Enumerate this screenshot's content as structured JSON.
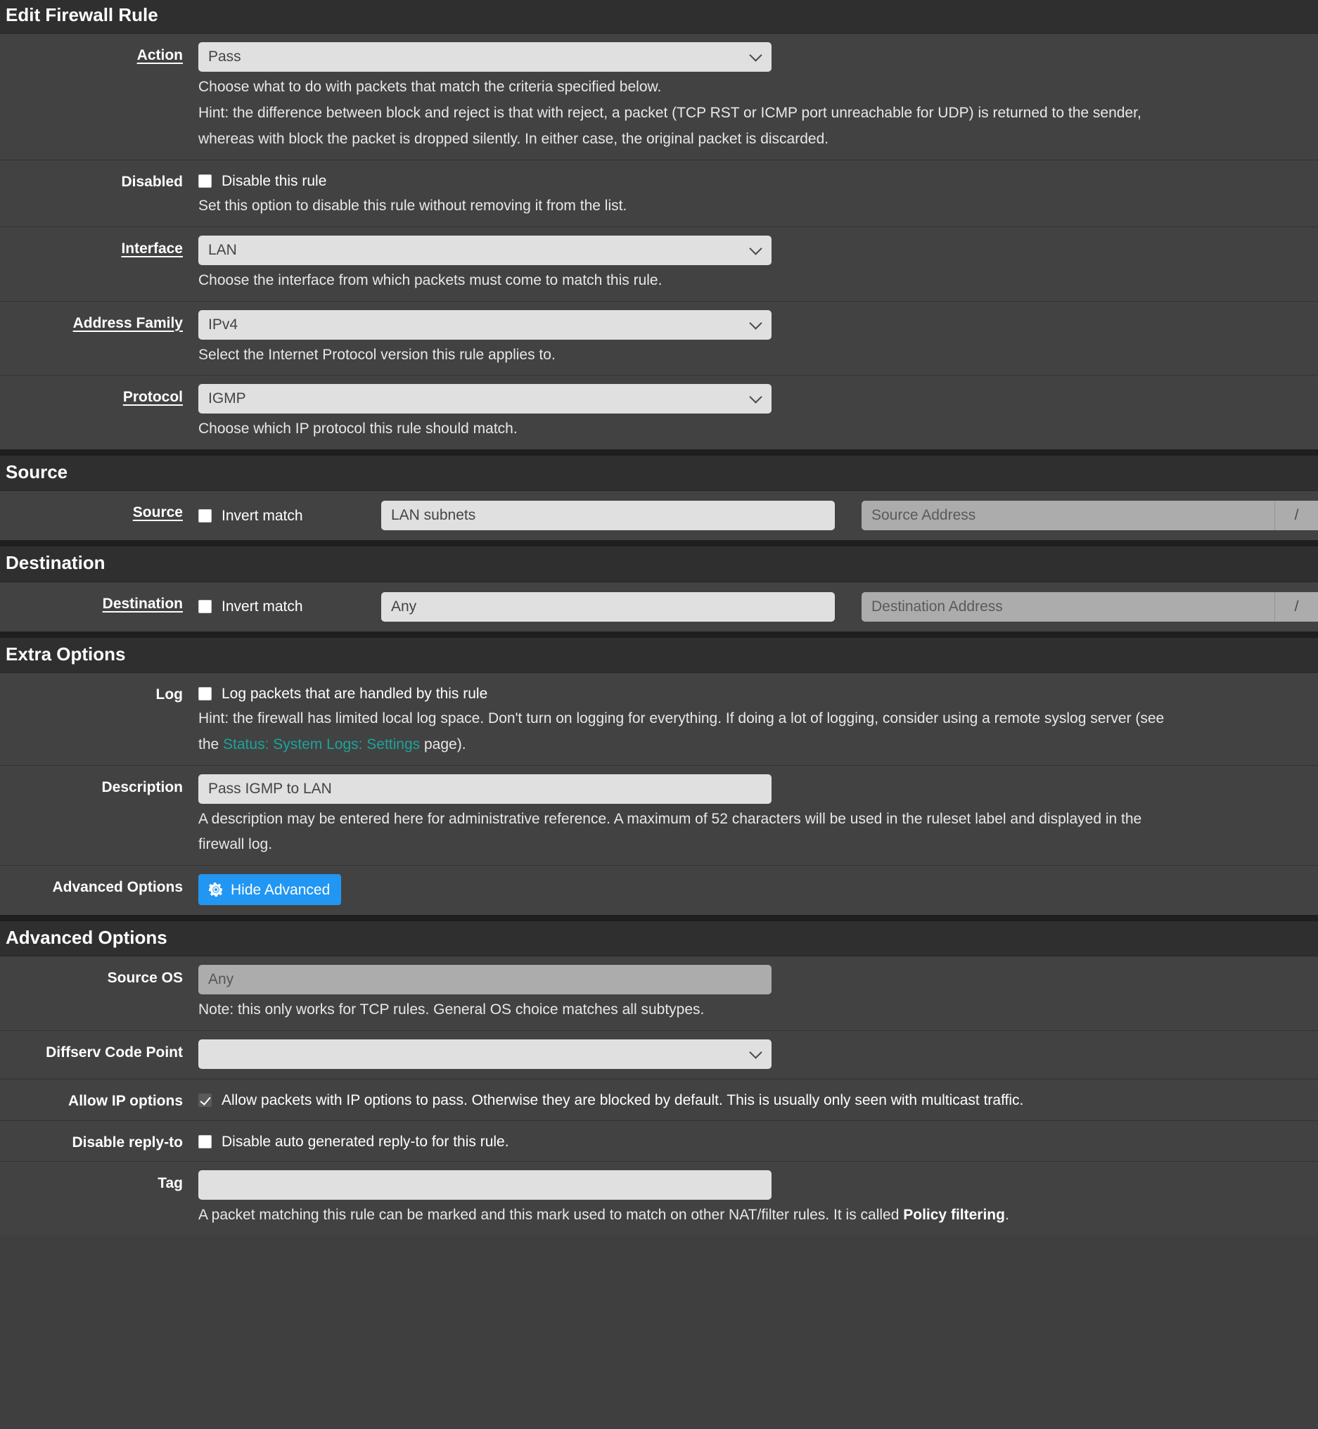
{
  "page": {
    "title": "Edit Firewall Rule"
  },
  "sections": {
    "source_heading": "Source",
    "destination_heading": "Destination",
    "extra_options_heading": "Extra Options",
    "advanced_options_heading": "Advanced Options"
  },
  "colors": {
    "accent_blue": "#2196f3",
    "link_teal": "#1ba39c",
    "panel_bg": "#424242",
    "heading_bg": "#2f2f2f"
  },
  "fields": {
    "action": {
      "label": "Action",
      "value": "Pass",
      "help_line1": "Choose what to do with packets that match the criteria specified below.",
      "help_line2": "Hint: the difference between block and reject is that with reject, a packet (TCP RST or ICMP port unreachable for UDP) is returned to the sender,",
      "help_line3": "whereas with block the packet is dropped silently. In either case, the original packet is discarded."
    },
    "disabled": {
      "label": "Disabled",
      "checkbox_label": "Disable this rule",
      "checked": false,
      "help": "Set this option to disable this rule without removing it from the list."
    },
    "interface": {
      "label": "Interface",
      "value": "LAN",
      "help": "Choose the interface from which packets must come to match this rule."
    },
    "address_family": {
      "label": "Address Family",
      "value": "IPv4",
      "help": "Select the Internet Protocol version this rule applies to."
    },
    "protocol": {
      "label": "Protocol",
      "value": "IGMP",
      "help": "Choose which IP protocol this rule should match."
    },
    "source": {
      "label": "Source",
      "invert_label": "Invert match",
      "invert_checked": false,
      "type_value": "LAN subnets",
      "address_placeholder": "Source Address",
      "slash": "/"
    },
    "destination": {
      "label": "Destination",
      "invert_label": "Invert match",
      "invert_checked": false,
      "type_value": "Any",
      "address_placeholder": "Destination Address",
      "slash": "/"
    },
    "log": {
      "label": "Log",
      "checkbox_label": "Log packets that are handled by this rule",
      "checked": false,
      "help_part1": "Hint: the firewall has limited local log space. Don't turn on logging for everything. If doing a lot of logging, consider using a remote syslog server (see",
      "help_line2_prefix": "the ",
      "help_link": "Status: System Logs: Settings",
      "help_line2_suffix": " page)."
    },
    "description": {
      "label": "Description",
      "value": "Pass IGMP to LAN",
      "help_line1": "A description may be entered here for administrative reference. A maximum of 52 characters will be used in the ruleset label and displayed in the",
      "help_line2": "firewall log."
    },
    "advanced_options_toggle": {
      "label": "Advanced Options",
      "button_label": "Hide Advanced",
      "icon": "gear-icon"
    },
    "source_os": {
      "label": "Source OS",
      "value": "Any",
      "disabled": true,
      "help": "Note: this only works for TCP rules. General OS choice matches all subtypes."
    },
    "diffserv": {
      "label": "Diffserv Code Point",
      "value": ""
    },
    "allow_ip_options": {
      "label": "Allow IP options",
      "checkbox_label": "Allow packets with IP options to pass. Otherwise they are blocked by default. This is usually only seen with multicast traffic.",
      "checked": true
    },
    "disable_reply_to": {
      "label": "Disable reply-to",
      "checkbox_label": "Disable auto generated reply-to for this rule.",
      "checked": false
    },
    "tag": {
      "label": "Tag",
      "value": "",
      "help_prefix": "A packet matching this rule can be marked and this mark used to match on other NAT/filter rules. It is called ",
      "help_bold": "Policy filtering",
      "help_suffix": "."
    }
  }
}
